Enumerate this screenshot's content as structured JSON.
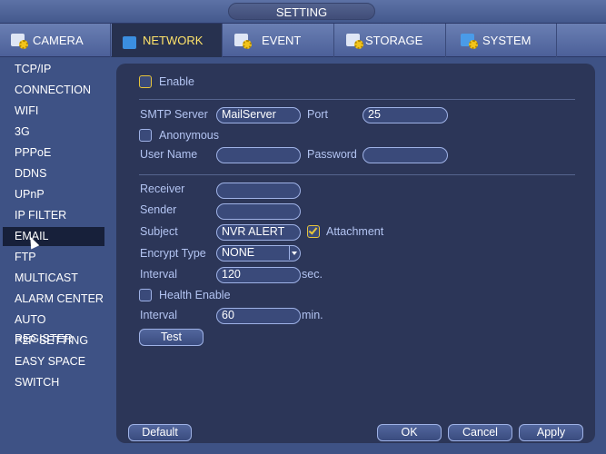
{
  "window": {
    "title": "SETTING"
  },
  "tabs": [
    {
      "label": "CAMERA",
      "icon": "camera-icon"
    },
    {
      "label": "NETWORK",
      "icon": "network-icon",
      "active": true
    },
    {
      "label": "EVENT",
      "icon": "event-icon"
    },
    {
      "label": "STORAGE",
      "icon": "storage-icon"
    },
    {
      "label": "SYSTEM",
      "icon": "system-icon"
    }
  ],
  "sidebar": {
    "items": [
      "TCP/IP",
      "CONNECTION",
      "WIFI",
      "3G",
      "PPPoE",
      "DDNS",
      "UPnP",
      "IP FILTER",
      "EMAIL",
      "FTP",
      "MULTICAST",
      "ALARM CENTER",
      "AUTO REGISTER",
      "P2P SETTING",
      "EASY SPACE",
      "SWITCH"
    ],
    "active": "EMAIL"
  },
  "form": {
    "enable": {
      "label": "Enable",
      "checked": false
    },
    "smtp_server": {
      "label": "SMTP Server",
      "value": "MailServer"
    },
    "port": {
      "label": "Port",
      "value": "25"
    },
    "anonymous": {
      "label": "Anonymous",
      "checked": false
    },
    "user_name": {
      "label": "User Name",
      "value": ""
    },
    "password": {
      "label": "Password",
      "value": ""
    },
    "receiver": {
      "label": "Receiver",
      "value": ""
    },
    "sender": {
      "label": "Sender",
      "value": ""
    },
    "subject": {
      "label": "Subject",
      "value": "NVR ALERT"
    },
    "attachment": {
      "label": "Attachment",
      "checked": true
    },
    "encrypt_type": {
      "label": "Encrypt Type",
      "value": "NONE"
    },
    "interval": {
      "label": "Interval",
      "value": "120",
      "unit": "sec."
    },
    "health_enable": {
      "label": "Health Enable",
      "checked": false
    },
    "health_interval": {
      "label": "Interval",
      "value": "60",
      "unit": "min."
    },
    "test_label": "Test"
  },
  "footer": {
    "default": "Default",
    "ok": "OK",
    "cancel": "Cancel",
    "apply": "Apply"
  },
  "colors": {
    "background": "#3e5285",
    "panel": "#2c3658",
    "label": "#b3c4f2",
    "active_tab_text": "#ffe36a",
    "highlight": "#e7c43a"
  }
}
